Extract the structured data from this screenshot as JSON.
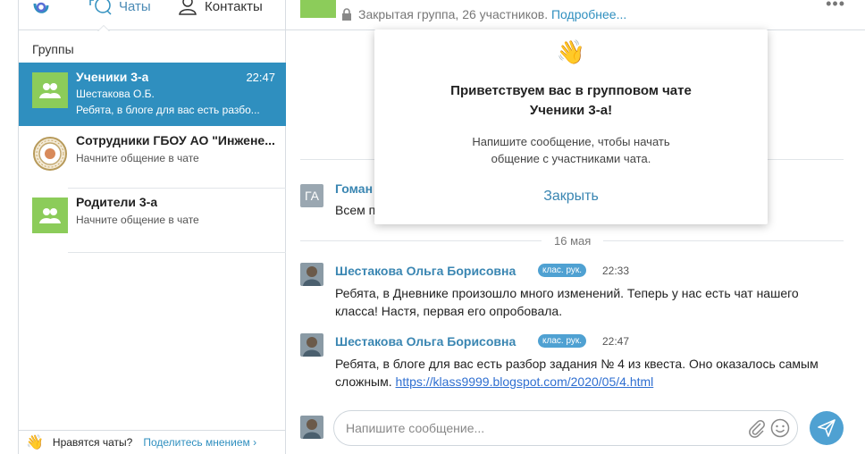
{
  "sidebar": {
    "tabs": {
      "chats": "Чаты",
      "contacts": "Контакты"
    },
    "groups_label": "Группы",
    "chats": [
      {
        "title": "Ученики 3-а",
        "time": "22:47",
        "author": "Шестакова О.Б.",
        "preview": "Ребята, в блоге для вас есть разбо...",
        "avatar": "group-icon"
      },
      {
        "title": "Сотрудники ГБОУ АО \"Инжене...",
        "preview": "Начните общение в чате",
        "avatar": "school-emblem"
      },
      {
        "title": "Родители 3-а",
        "preview": "Начните общение в чате",
        "avatar": "group-icon"
      }
    ],
    "footer": {
      "question": "Нравятся чаты?",
      "link": "Поделитесь мнением ›"
    }
  },
  "header": {
    "info": "Закрытая группа, 26 участников.",
    "more_link": "Подробнее..."
  },
  "messages": {
    "partial": {
      "avatar_initials": "ГА",
      "author": "Гоман",
      "text": "Всем п"
    },
    "date": "16 мая",
    "items": [
      {
        "author": "Шестакова Ольга Борисовна",
        "badge": "клас. рук.",
        "time": "22:33",
        "text": "Ребята, в Дневнике произошло много изменений. Теперь у нас есть чат нашего класса! Настя, первая его опробовала."
      },
      {
        "author": "Шестакова Ольга Борисовна",
        "badge": "клас. рук.",
        "time": "22:47",
        "text": "Ребята, в блоге для вас есть разбор задания № 4 из квеста. Оно оказалось самым сложным.",
        "link": "https://klass9999.blogspot.com/2020/05/4.html"
      }
    ]
  },
  "popup": {
    "emoji": "👋",
    "title_line1": "Приветствуем вас в групповом чате",
    "title_line2": "Ученики 3-а!",
    "text_line1": "Напишите сообщение, чтобы начать",
    "text_line2": "общение с участниками чата.",
    "close": "Закрыть"
  },
  "composer": {
    "placeholder": "Напишите сообщение..."
  },
  "colors": {
    "accent": "#2f8fbf",
    "group_avatar": "#8ccc5a",
    "badge": "#4fa1d2"
  }
}
